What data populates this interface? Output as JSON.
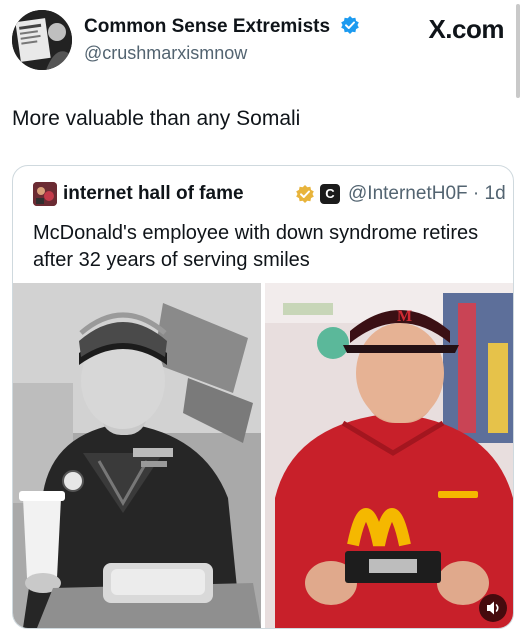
{
  "post": {
    "author_name": "Common Sense Extremists",
    "author_handle": "@crushmarxismnow",
    "source_site": "X.com",
    "text": "More valuable than any Somali",
    "icons": {
      "verified": "verified-badge-icon",
      "avatar": "newspaper-avatar"
    }
  },
  "quoted_post": {
    "author_name": "internet hall of fame",
    "badge_letter": "C",
    "author_handle": "@InternetH0F",
    "time": "· 1d",
    "text": "McDonald's employee with down syndrome retires after 32 years of serving smiles",
    "icons": {
      "verified": "gold-verified-badge-icon",
      "affiliate": "affiliate-badge-icon",
      "audio": "speaker-icon"
    }
  },
  "colors": {
    "verified_blue": "#1d9bf0",
    "verified_gold": "#e8b43c",
    "secondary_text": "#536471",
    "uniform_red": "#c8202a",
    "mcdonalds_yellow": "#f5b800"
  }
}
